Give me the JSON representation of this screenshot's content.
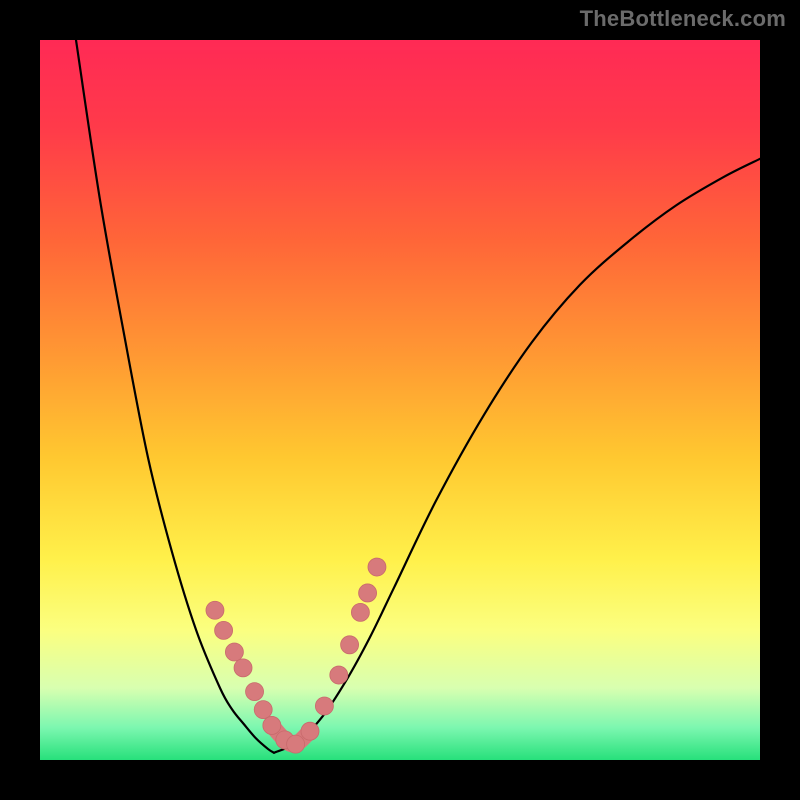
{
  "watermark": "TheBottleneck.com",
  "colors": {
    "frame": "#000000",
    "gradient_stops": [
      {
        "pos": 0.0,
        "color": "#ff2a55"
      },
      {
        "pos": 0.12,
        "color": "#ff3a4a"
      },
      {
        "pos": 0.28,
        "color": "#ff6638"
      },
      {
        "pos": 0.44,
        "color": "#ff9933"
      },
      {
        "pos": 0.58,
        "color": "#ffc830"
      },
      {
        "pos": 0.72,
        "color": "#fff04a"
      },
      {
        "pos": 0.82,
        "color": "#fbff80"
      },
      {
        "pos": 0.9,
        "color": "#d8ffb0"
      },
      {
        "pos": 0.955,
        "color": "#7cf7b0"
      },
      {
        "pos": 1.0,
        "color": "#27e07b"
      }
    ],
    "curve": "#000000",
    "bead": "#d77a7c"
  },
  "chart_data": {
    "type": "line",
    "title": "",
    "xlabel": "",
    "ylabel": "",
    "xlim": [
      0,
      1
    ],
    "ylim": [
      0,
      1
    ],
    "series": [
      {
        "name": "left-curve",
        "x": [
          0.05,
          0.083,
          0.117,
          0.15,
          0.183,
          0.217,
          0.25,
          0.267,
          0.283,
          0.3,
          0.317,
          0.325
        ],
        "y": [
          1.0,
          0.78,
          0.59,
          0.42,
          0.29,
          0.18,
          0.1,
          0.07,
          0.05,
          0.03,
          0.015,
          0.01
        ]
      },
      {
        "name": "right-curve",
        "x": [
          0.325,
          0.358,
          0.392,
          0.425,
          0.458,
          0.492,
          0.55,
          0.617,
          0.683,
          0.75,
          0.817,
          0.883,
          0.95,
          1.0
        ],
        "y": [
          0.01,
          0.025,
          0.06,
          0.11,
          0.17,
          0.24,
          0.36,
          0.48,
          0.58,
          0.66,
          0.72,
          0.77,
          0.81,
          0.835
        ]
      }
    ],
    "beads": {
      "name": "highlight-dots",
      "x": [
        0.243,
        0.255,
        0.27,
        0.282,
        0.298,
        0.31,
        0.322,
        0.34,
        0.355,
        0.375,
        0.395,
        0.415,
        0.43,
        0.445,
        0.455,
        0.468
      ],
      "y": [
        0.208,
        0.18,
        0.15,
        0.128,
        0.095,
        0.07,
        0.048,
        0.028,
        0.022,
        0.04,
        0.075,
        0.118,
        0.16,
        0.205,
        0.232,
        0.268
      ]
    }
  }
}
